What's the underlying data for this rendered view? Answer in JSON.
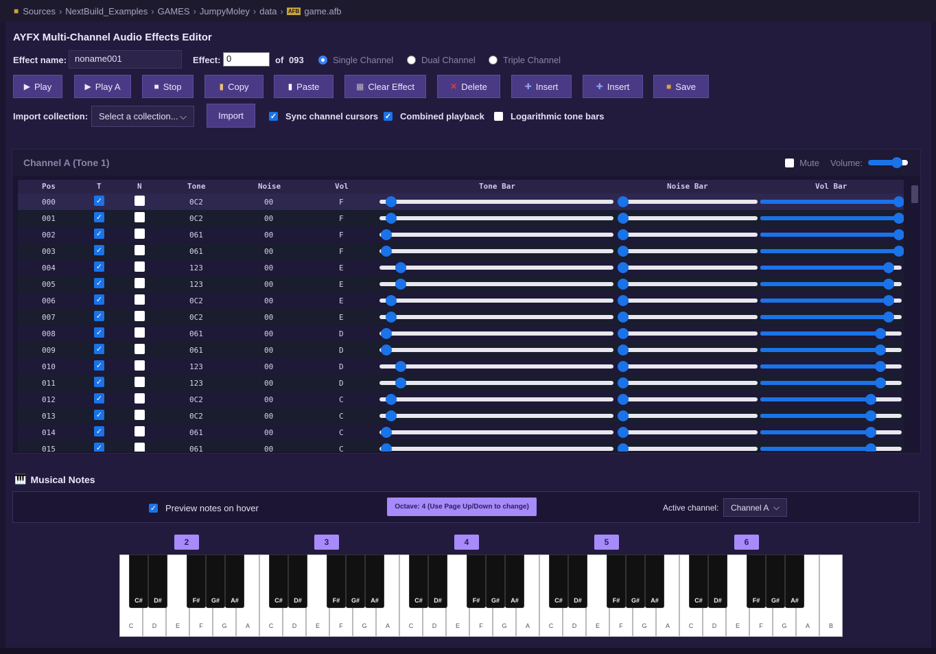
{
  "breadcrumb": [
    "Sources",
    "NextBuild_Examples",
    "GAMES",
    "JumpyMoley",
    "data",
    "game.afb"
  ],
  "file_badge": "AFB",
  "title": "AYFX Multi-Channel Audio Effects Editor",
  "effect_name_label": "Effect name:",
  "effect_name_value": "noname001",
  "effect_label": "Effect:",
  "effect_value": "0",
  "of_label": "of",
  "effect_count": "093",
  "modes": [
    "Single Channel",
    "Dual Channel",
    "Triple Channel"
  ],
  "toolbar": {
    "play": "Play",
    "play_a": "Play A",
    "stop": "Stop",
    "copy": "Copy",
    "paste": "Paste",
    "clear": "Clear Effect",
    "delete": "Delete",
    "insert1": "Insert",
    "insert2": "Insert",
    "save": "Save"
  },
  "import_label": "Import collection:",
  "import_select": "Select a collection...",
  "import_button": "Import",
  "options": {
    "sync": "Sync channel cursors",
    "combined": "Combined playback",
    "log": "Logarithmic tone bars"
  },
  "channel": {
    "title": "Channel A (Tone 1)",
    "mute": "Mute",
    "volume": "Volume:"
  },
  "columns": [
    "Pos",
    "T",
    "N",
    "Tone",
    "Noise",
    "Vol",
    "Tone Bar",
    "Noise Bar",
    "Vol Bar"
  ],
  "rows": [
    {
      "pos": "000",
      "t": true,
      "n": false,
      "tone": "0C2",
      "noise": "00",
      "vol": "F"
    },
    {
      "pos": "001",
      "t": true,
      "n": false,
      "tone": "0C2",
      "noise": "00",
      "vol": "F"
    },
    {
      "pos": "002",
      "t": true,
      "n": false,
      "tone": "061",
      "noise": "00",
      "vol": "F"
    },
    {
      "pos": "003",
      "t": true,
      "n": false,
      "tone": "061",
      "noise": "00",
      "vol": "F"
    },
    {
      "pos": "004",
      "t": true,
      "n": false,
      "tone": "123",
      "noise": "00",
      "vol": "E"
    },
    {
      "pos": "005",
      "t": true,
      "n": false,
      "tone": "123",
      "noise": "00",
      "vol": "E"
    },
    {
      "pos": "006",
      "t": true,
      "n": false,
      "tone": "0C2",
      "noise": "00",
      "vol": "E"
    },
    {
      "pos": "007",
      "t": true,
      "n": false,
      "tone": "0C2",
      "noise": "00",
      "vol": "E"
    },
    {
      "pos": "008",
      "t": true,
      "n": false,
      "tone": "061",
      "noise": "00",
      "vol": "D"
    },
    {
      "pos": "009",
      "t": true,
      "n": false,
      "tone": "061",
      "noise": "00",
      "vol": "D"
    },
    {
      "pos": "010",
      "t": true,
      "n": false,
      "tone": "123",
      "noise": "00",
      "vol": "D"
    },
    {
      "pos": "011",
      "t": true,
      "n": false,
      "tone": "123",
      "noise": "00",
      "vol": "D"
    },
    {
      "pos": "012",
      "t": true,
      "n": false,
      "tone": "0C2",
      "noise": "00",
      "vol": "C"
    },
    {
      "pos": "013",
      "t": true,
      "n": false,
      "tone": "0C2",
      "noise": "00",
      "vol": "C"
    },
    {
      "pos": "014",
      "t": true,
      "n": false,
      "tone": "061",
      "noise": "00",
      "vol": "C"
    },
    {
      "pos": "015",
      "t": true,
      "n": false,
      "tone": "061",
      "noise": "00",
      "vol": "C"
    }
  ],
  "notes": {
    "title": "Musical Notes",
    "preview": "Preview notes on hover",
    "octave": "Octave: 4 (Use Page Up/Down to change)",
    "active_label": "Active channel:",
    "active_value": "Channel A",
    "octave_labels": [
      "2",
      "3",
      "4",
      "5",
      "6"
    ],
    "white_keys": [
      "C",
      "D",
      "E",
      "F",
      "G",
      "A",
      "B"
    ],
    "black_keys": [
      "C#",
      "D#",
      "F#",
      "G#",
      "A#"
    ],
    "last_key": "B"
  },
  "colors": {
    "accent": "#1a73e8",
    "button": "#4a3a86",
    "octave": "#a78bfa",
    "delete": "#e53935"
  },
  "icons": {
    "folder": "folder-icon",
    "piano": "piano-icon",
    "play": "play-icon",
    "stop": "stop-icon",
    "copy": "clipboard-icon",
    "paste": "paste-icon",
    "clear": "clear-icon",
    "delete": "x-icon",
    "insert": "plus-icon",
    "save": "box-icon"
  }
}
